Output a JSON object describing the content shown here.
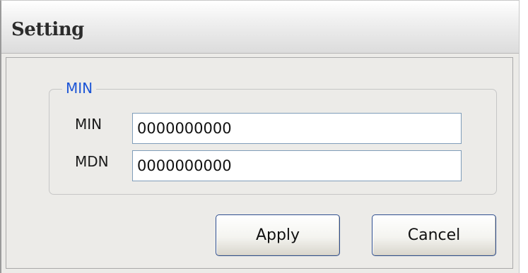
{
  "window": {
    "title": "Setting"
  },
  "group": {
    "legend": "MIN"
  },
  "fields": {
    "min": {
      "label": "MIN",
      "value": "0000000000"
    },
    "mdn": {
      "label": "MDN",
      "value": "0000000000"
    }
  },
  "buttons": {
    "apply_label": "Apply",
    "cancel_label": "Cancel"
  },
  "colors": {
    "legend_text": "#1c55d6",
    "dialog_background": "#ecebe8",
    "input_border": "#7f9db9",
    "button_border": "#2d4d8e"
  }
}
